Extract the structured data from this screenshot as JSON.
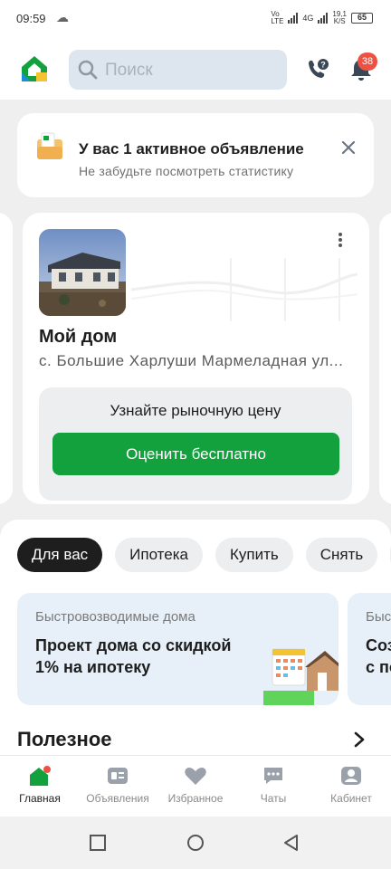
{
  "status_bar": {
    "time": "09:59",
    "network": "4G",
    "speed_value": "19,1",
    "speed_unit": "K/S",
    "battery": "65"
  },
  "header": {
    "search_placeholder": "Поиск",
    "notification_count": "38"
  },
  "notice": {
    "title": "У вас 1 активное объявление",
    "subtitle": "Не забудьте посмотреть статистику"
  },
  "listing": {
    "name": "Мой дом",
    "address": "с. Большие Харлуши Мармеладная ул...",
    "price_hint": "Узнайте рыночную цену",
    "cta": "Оценить бесплатно"
  },
  "chips": [
    "Для вас",
    "Ипотека",
    "Купить",
    "Снять"
  ],
  "promos": [
    {
      "category": "Быстровозводимые дома",
      "headline": "Проект дома со скидкой 1% на ипотеку"
    },
    {
      "category": "Быс",
      "headline_line1": "Соз",
      "headline_line2": "с по"
    }
  ],
  "section": {
    "title": "Полезное"
  },
  "tabs": [
    {
      "label": "Главная",
      "icon": "home-icon",
      "active": true
    },
    {
      "label": "Объявления",
      "icon": "listings-icon",
      "active": false
    },
    {
      "label": "Избранное",
      "icon": "heart-icon",
      "active": false
    },
    {
      "label": "Чаты",
      "icon": "chat-icon",
      "active": false
    },
    {
      "label": "Кабинет",
      "icon": "profile-icon",
      "active": false
    }
  ],
  "colors": {
    "brand_green": "#12a13d",
    "badge_red": "#ee5141",
    "search_bg": "#dde6ef",
    "promo_bg": "#e7f0f8"
  }
}
